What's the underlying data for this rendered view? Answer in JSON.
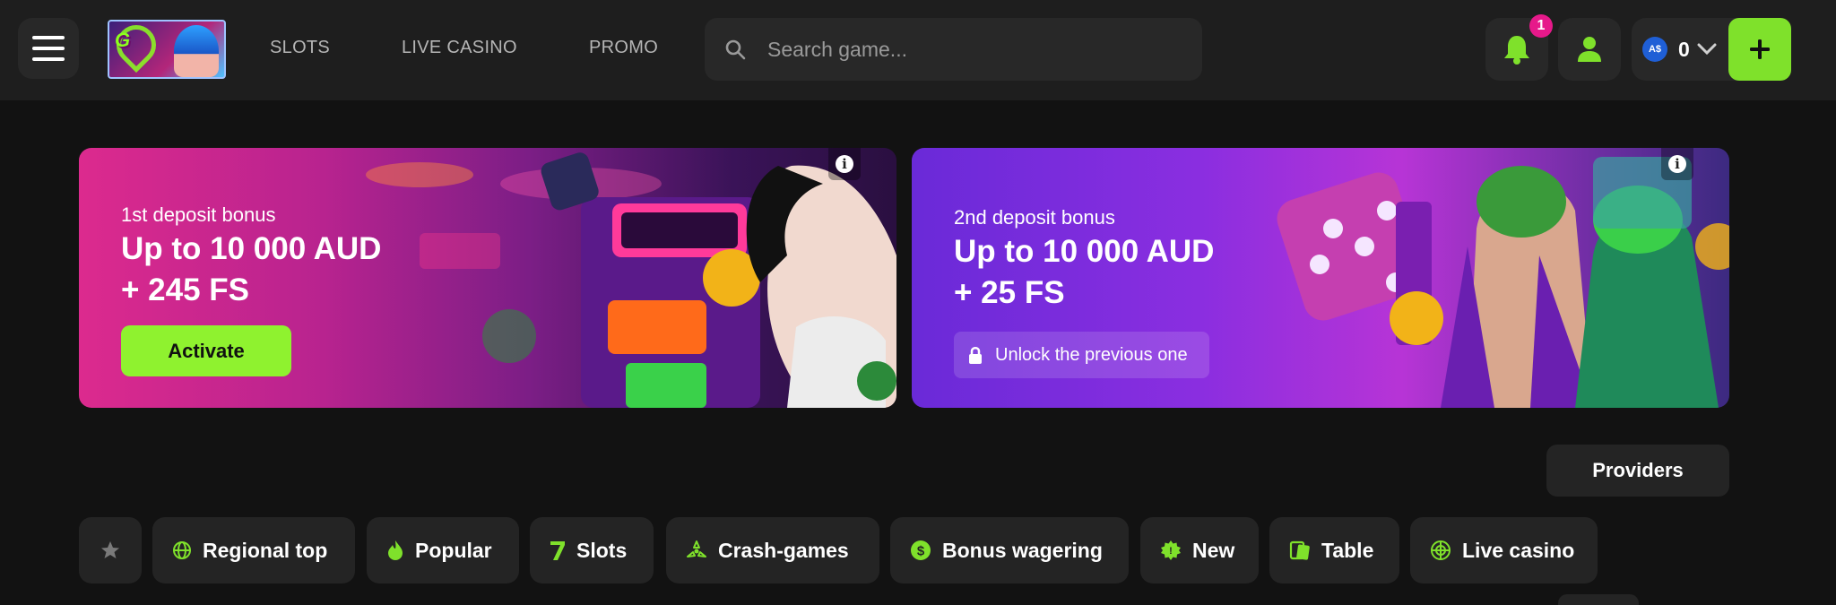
{
  "header": {
    "nav": [
      "SLOTS",
      "LIVE CASINO",
      "PROMO"
    ],
    "search_placeholder": "Search game...",
    "notifications_count": "1",
    "wallet": {
      "currency_badge": "A$",
      "balance": "0"
    },
    "colors": {
      "accent": "#7fe12b",
      "badge": "#e6198a",
      "surface": "#282828"
    }
  },
  "banners": [
    {
      "subtitle": "1st deposit bonus",
      "title_line1": "Up to 10 000 AUD",
      "title_line2": "+ 245 FS",
      "button": "Activate"
    },
    {
      "subtitle": "2nd deposit bonus",
      "title_line1": "Up to 10 000 AUD",
      "title_line2": "+ 25 FS",
      "button": "Unlock the previous one"
    }
  ],
  "providers_label": "Providers",
  "categories": [
    {
      "label": "Regional top",
      "icon": "globe-icon"
    },
    {
      "label": "Popular",
      "icon": "flame-icon"
    },
    {
      "label": "Slots",
      "icon": "seven-icon"
    },
    {
      "label": "Crash-games",
      "icon": "radiation-icon"
    },
    {
      "label": "Bonus wagering",
      "icon": "dollar-icon"
    },
    {
      "label": "New",
      "icon": "new-badge-icon"
    },
    {
      "label": "Table",
      "icon": "cards-icon"
    },
    {
      "label": "Live casino",
      "icon": "live-globe-icon"
    }
  ]
}
